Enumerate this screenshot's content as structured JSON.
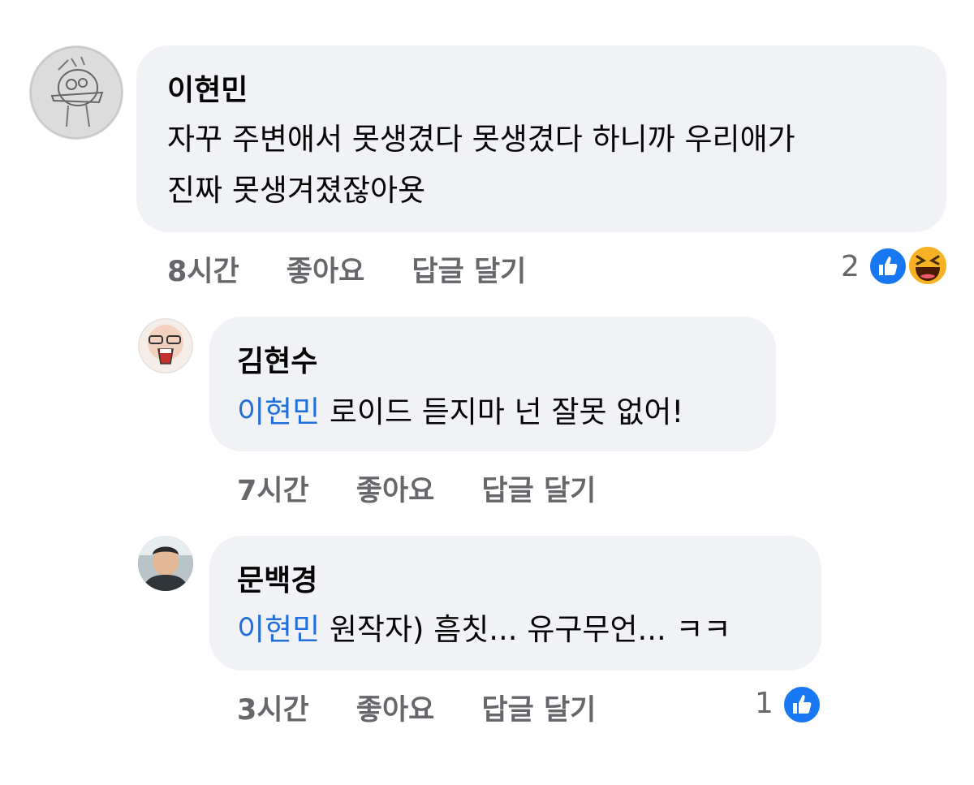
{
  "comments": [
    {
      "author": "이현민",
      "lines": [
        "자꾸 주변애서 못생겼다 못생겼다 하니까 우리애가",
        "진짜 못생겨졌잖아욧"
      ],
      "time": "8시간",
      "like_label": "좋아요",
      "reply_label": "답글 달기",
      "reaction_count": "2",
      "reactions": [
        "like-icon",
        "haha-icon"
      ]
    },
    {
      "author": "김현수",
      "mention": "이현민",
      "text": "로이드 듣지마 넌 잘못 없어!",
      "time": "7시간",
      "like_label": "좋아요",
      "reply_label": "답글 달기"
    },
    {
      "author": "문백경",
      "mention": "이현민",
      "text": "원작자) 흠칫... 유구무언... ㅋㅋ",
      "time": "3시간",
      "like_label": "좋아요",
      "reply_label": "답글 달기",
      "reaction_count": "1",
      "reactions": [
        "like-icon"
      ]
    }
  ],
  "colors": {
    "bubble": "#f0f2f5",
    "mention": "#216fdb",
    "meta": "#65676b",
    "like": "#1877f2",
    "haha": "#f7b125"
  }
}
